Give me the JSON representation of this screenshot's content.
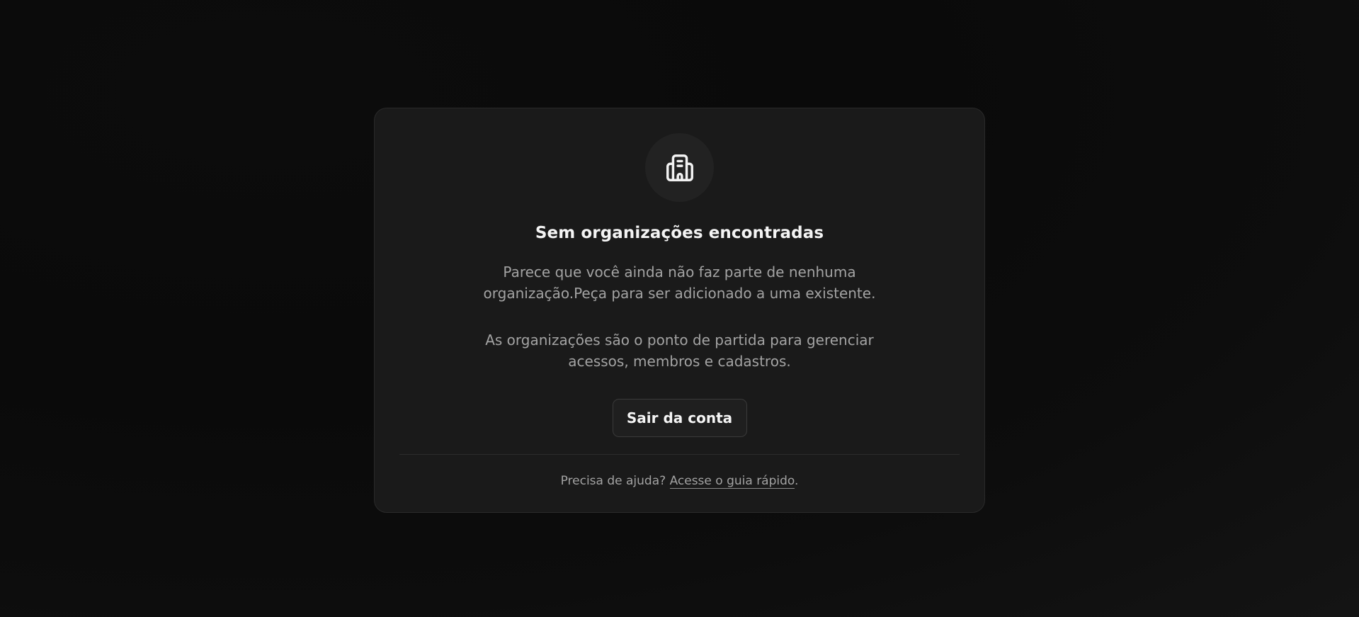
{
  "empty_state": {
    "icon": "building-icon",
    "title": "Sem organizações encontradas",
    "description_1_line_1": "Parece que você ainda não faz parte de nenhuma",
    "description_1_line_2": "organização.Peça para ser adicionado a uma existente.",
    "description_2_line_1": "As organizações são o ponto de partida para gerenciar",
    "description_2_line_2": "acessos, membros e cadastros.",
    "logout_label": "Sair da conta"
  },
  "help": {
    "prefix": "Precisa de ajuda? ",
    "link_label": "Acesse o guia rápido",
    "suffix": "."
  },
  "colors": {
    "background": "#0a0a0a",
    "card": "#1a1a1a",
    "title_text": "#f4f4f4",
    "body_text": "#a3a3a3"
  }
}
